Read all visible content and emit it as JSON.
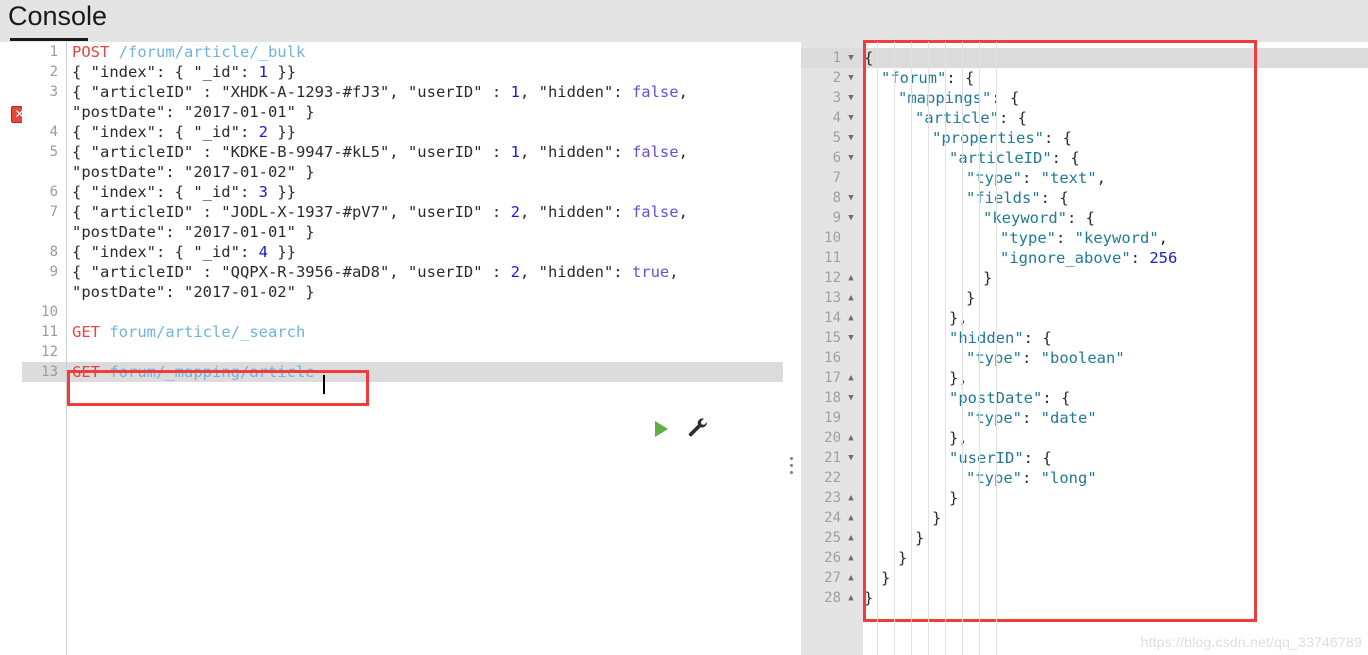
{
  "header": {
    "title": "Console"
  },
  "left_editor": {
    "name": "request-editor",
    "error_marker": {
      "line": 3,
      "icon": "error-x-icon",
      "glyph": "✕"
    },
    "active_line": 13,
    "caret_after": "GET forum/_mapping/article",
    "run_button_label": "▶",
    "wrench_button_label": "wrench",
    "lines": [
      {
        "num": "1",
        "segments": [
          {
            "t": "POST",
            "c": "k-method"
          },
          {
            "t": " ",
            "c": "k-punct"
          },
          {
            "t": "/forum/article/_bulk",
            "c": "k-url"
          }
        ]
      },
      {
        "num": "2",
        "segments": [
          {
            "t": "{ \"index\": { \"_id\": ",
            "c": "k-punct"
          },
          {
            "t": "1",
            "c": "k-num"
          },
          {
            "t": " }}",
            "c": "k-punct"
          }
        ]
      },
      {
        "num": "3",
        "segments": [
          {
            "t": "{ \"articleID\" : \"XHDK-A-1293-#fJ3\", \"userID\" : ",
            "c": "k-punct"
          },
          {
            "t": "1",
            "c": "k-num"
          },
          {
            "t": ", \"hidden\": ",
            "c": "k-punct"
          },
          {
            "t": "false",
            "c": "k-bool"
          },
          {
            "t": ",",
            "c": "k-punct"
          }
        ]
      },
      {
        "num": "",
        "segments": [
          {
            "t": "\"postDate\": \"2017-01-01\" }",
            "c": "k-punct"
          }
        ]
      },
      {
        "num": "4",
        "segments": [
          {
            "t": "{ \"index\": { \"_id\": ",
            "c": "k-punct"
          },
          {
            "t": "2",
            "c": "k-num"
          },
          {
            "t": " }}",
            "c": "k-punct"
          }
        ]
      },
      {
        "num": "5",
        "segments": [
          {
            "t": "{ \"articleID\" : \"KDKE-B-9947-#kL5\", \"userID\" : ",
            "c": "k-punct"
          },
          {
            "t": "1",
            "c": "k-num"
          },
          {
            "t": ", \"hidden\": ",
            "c": "k-punct"
          },
          {
            "t": "false",
            "c": "k-bool"
          },
          {
            "t": ",",
            "c": "k-punct"
          }
        ]
      },
      {
        "num": "",
        "segments": [
          {
            "t": "\"postDate\": \"2017-01-02\" }",
            "c": "k-punct"
          }
        ]
      },
      {
        "num": "6",
        "segments": [
          {
            "t": "{ \"index\": { \"_id\": ",
            "c": "k-punct"
          },
          {
            "t": "3",
            "c": "k-num"
          },
          {
            "t": " }}",
            "c": "k-punct"
          }
        ]
      },
      {
        "num": "7",
        "segments": [
          {
            "t": "{ \"articleID\" : \"JODL-X-1937-#pV7\", \"userID\" : ",
            "c": "k-punct"
          },
          {
            "t": "2",
            "c": "k-num"
          },
          {
            "t": ", \"hidden\": ",
            "c": "k-punct"
          },
          {
            "t": "false",
            "c": "k-bool"
          },
          {
            "t": ",",
            "c": "k-punct"
          }
        ]
      },
      {
        "num": "",
        "segments": [
          {
            "t": "\"postDate\": \"2017-01-01\" }",
            "c": "k-punct"
          }
        ]
      },
      {
        "num": "8",
        "segments": [
          {
            "t": "{ \"index\": { \"_id\": ",
            "c": "k-punct"
          },
          {
            "t": "4",
            "c": "k-num"
          },
          {
            "t": " }}",
            "c": "k-punct"
          }
        ]
      },
      {
        "num": "9",
        "segments": [
          {
            "t": "{ \"articleID\" : \"QQPX-R-3956-#aD8\", \"userID\" : ",
            "c": "k-punct"
          },
          {
            "t": "2",
            "c": "k-num"
          },
          {
            "t": ", \"hidden\": ",
            "c": "k-punct"
          },
          {
            "t": "true",
            "c": "k-bool"
          },
          {
            "t": ",",
            "c": "k-punct"
          }
        ]
      },
      {
        "num": "",
        "segments": [
          {
            "t": "\"postDate\": \"2017-01-02\" }",
            "c": "k-punct"
          }
        ]
      },
      {
        "num": "10",
        "segments": []
      },
      {
        "num": "11",
        "segments": [
          {
            "t": "GET",
            "c": "k-method"
          },
          {
            "t": " ",
            "c": "k-punct"
          },
          {
            "t": "forum/article/_search",
            "c": "k-url"
          }
        ]
      },
      {
        "num": "12",
        "segments": []
      },
      {
        "num": "13",
        "highlight": true,
        "segments": [
          {
            "t": "GET",
            "c": "k-method"
          },
          {
            "t": " ",
            "c": "k-punct"
          },
          {
            "t": "forum/_mapping/article",
            "c": "k-url"
          }
        ]
      }
    ]
  },
  "right_panel": {
    "name": "response-viewer",
    "active_line": 1,
    "lines": [
      {
        "num": "1",
        "fold": "▼",
        "highlight": true,
        "indent": 0,
        "segments": [
          {
            "t": "{",
            "c": "j-p"
          }
        ]
      },
      {
        "num": "2",
        "fold": "▼",
        "indent": 1,
        "segments": [
          {
            "t": "\"forum\"",
            "c": "j-key"
          },
          {
            "t": ": {",
            "c": "j-p"
          }
        ]
      },
      {
        "num": "3",
        "fold": "▼",
        "indent": 2,
        "segments": [
          {
            "t": "\"mappings\"",
            "c": "j-key"
          },
          {
            "t": ": {",
            "c": "j-p"
          }
        ]
      },
      {
        "num": "4",
        "fold": "▼",
        "indent": 3,
        "segments": [
          {
            "t": "\"article\"",
            "c": "j-key"
          },
          {
            "t": ": {",
            "c": "j-p"
          }
        ]
      },
      {
        "num": "5",
        "fold": "▼",
        "indent": 4,
        "segments": [
          {
            "t": "\"properties\"",
            "c": "j-key"
          },
          {
            "t": ": {",
            "c": "j-p"
          }
        ]
      },
      {
        "num": "6",
        "fold": "▼",
        "indent": 5,
        "segments": [
          {
            "t": "\"articleID\"",
            "c": "j-key"
          },
          {
            "t": ": {",
            "c": "j-p"
          }
        ]
      },
      {
        "num": "7",
        "fold": "",
        "indent": 6,
        "segments": [
          {
            "t": "\"type\"",
            "c": "j-key"
          },
          {
            "t": ": ",
            "c": "j-p"
          },
          {
            "t": "\"text\"",
            "c": "j-str"
          },
          {
            "t": ",",
            "c": "j-p"
          }
        ]
      },
      {
        "num": "8",
        "fold": "▼",
        "indent": 6,
        "segments": [
          {
            "t": "\"fields\"",
            "c": "j-key"
          },
          {
            "t": ": {",
            "c": "j-p"
          }
        ]
      },
      {
        "num": "9",
        "fold": "▼",
        "indent": 7,
        "segments": [
          {
            "t": "\"keyword\"",
            "c": "j-key"
          },
          {
            "t": ": {",
            "c": "j-p"
          }
        ]
      },
      {
        "num": "10",
        "fold": "",
        "indent": 8,
        "segments": [
          {
            "t": "\"type\"",
            "c": "j-key"
          },
          {
            "t": ": ",
            "c": "j-p"
          },
          {
            "t": "\"keyword\"",
            "c": "j-str"
          },
          {
            "t": ",",
            "c": "j-p"
          }
        ]
      },
      {
        "num": "11",
        "fold": "",
        "indent": 8,
        "segments": [
          {
            "t": "\"ignore_above\"",
            "c": "j-key"
          },
          {
            "t": ": ",
            "c": "j-p"
          },
          {
            "t": "256",
            "c": "j-num"
          }
        ]
      },
      {
        "num": "12",
        "fold": "▲",
        "indent": 7,
        "segments": [
          {
            "t": "}",
            "c": "j-p"
          }
        ]
      },
      {
        "num": "13",
        "fold": "▲",
        "indent": 6,
        "segments": [
          {
            "t": "}",
            "c": "j-p"
          }
        ]
      },
      {
        "num": "14",
        "fold": "▲",
        "indent": 5,
        "segments": [
          {
            "t": "},",
            "c": "j-p"
          }
        ]
      },
      {
        "num": "15",
        "fold": "▼",
        "indent": 5,
        "segments": [
          {
            "t": "\"hidden\"",
            "c": "j-key"
          },
          {
            "t": ": {",
            "c": "j-p"
          }
        ]
      },
      {
        "num": "16",
        "fold": "",
        "indent": 6,
        "segments": [
          {
            "t": "\"type\"",
            "c": "j-key"
          },
          {
            "t": ": ",
            "c": "j-p"
          },
          {
            "t": "\"boolean\"",
            "c": "j-str"
          }
        ]
      },
      {
        "num": "17",
        "fold": "▲",
        "indent": 5,
        "segments": [
          {
            "t": "},",
            "c": "j-p"
          }
        ]
      },
      {
        "num": "18",
        "fold": "▼",
        "indent": 5,
        "segments": [
          {
            "t": "\"postDate\"",
            "c": "j-key"
          },
          {
            "t": ": {",
            "c": "j-p"
          }
        ]
      },
      {
        "num": "19",
        "fold": "",
        "indent": 6,
        "segments": [
          {
            "t": "\"type\"",
            "c": "j-key"
          },
          {
            "t": ": ",
            "c": "j-p"
          },
          {
            "t": "\"date\"",
            "c": "j-str"
          }
        ]
      },
      {
        "num": "20",
        "fold": "▲",
        "indent": 5,
        "segments": [
          {
            "t": "},",
            "c": "j-p"
          }
        ]
      },
      {
        "num": "21",
        "fold": "▼",
        "indent": 5,
        "segments": [
          {
            "t": "\"userID\"",
            "c": "j-key"
          },
          {
            "t": ": {",
            "c": "j-p"
          }
        ]
      },
      {
        "num": "22",
        "fold": "",
        "indent": 6,
        "segments": [
          {
            "t": "\"type\"",
            "c": "j-key"
          },
          {
            "t": ": ",
            "c": "j-p"
          },
          {
            "t": "\"long\"",
            "c": "j-str"
          }
        ]
      },
      {
        "num": "23",
        "fold": "▲",
        "indent": 5,
        "segments": [
          {
            "t": "}",
            "c": "j-p"
          }
        ]
      },
      {
        "num": "24",
        "fold": "▲",
        "indent": 4,
        "segments": [
          {
            "t": "}",
            "c": "j-p"
          }
        ]
      },
      {
        "num": "25",
        "fold": "▲",
        "indent": 3,
        "segments": [
          {
            "t": "}",
            "c": "j-p"
          }
        ]
      },
      {
        "num": "26",
        "fold": "▲",
        "indent": 2,
        "segments": [
          {
            "t": "}",
            "c": "j-p"
          }
        ]
      },
      {
        "num": "27",
        "fold": "▲",
        "indent": 1,
        "segments": [
          {
            "t": "}",
            "c": "j-p"
          }
        ]
      },
      {
        "num": "28",
        "fold": "▲",
        "indent": 0,
        "segments": [
          {
            "t": "}",
            "c": "j-p"
          }
        ]
      }
    ]
  },
  "annotations": {
    "left_box_color": "#f23b3b",
    "right_box_color": "#f23b3b"
  },
  "watermark": {
    "text": "https://blog.csdn.net/qq_33746789"
  }
}
